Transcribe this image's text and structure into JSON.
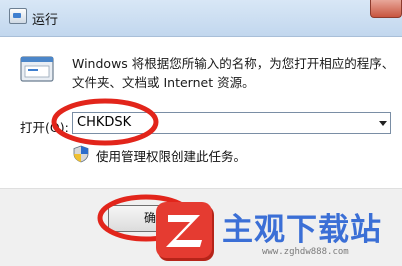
{
  "window": {
    "title": "运行"
  },
  "description": {
    "line1": "Windows 将根据您所输入的名称，为您打开相应的程序、",
    "line2": "文件夹、文档或 Internet 资源。"
  },
  "open_field": {
    "label": "打开(O):",
    "value": "CHKDSK"
  },
  "admin_note": "使用管理权限创建此任务。",
  "buttons": {
    "ok_label": "确"
  },
  "watermark": {
    "brand": "主观下载站",
    "url": "www.zghdw888.com"
  },
  "colors": {
    "annotation_circle": "#e2251b",
    "watermark_blue": "#3b6fd6",
    "watermark_badge": "#e53b31"
  },
  "icons": {
    "app": "run-dialog-icon",
    "run": "run-window-icon",
    "uac": "uac-shield-icon",
    "close": "close-icon"
  }
}
